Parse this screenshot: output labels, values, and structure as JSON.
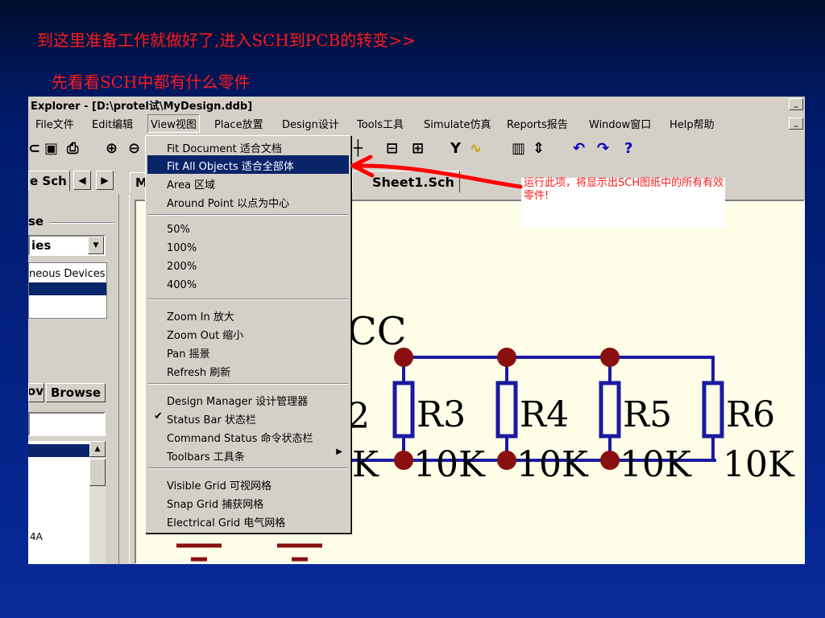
{
  "slide": {
    "line1": "到这里准备工作就做好了,进入SCH到PCB的转变>>",
    "line2": "先看看SCH中都有什么零件"
  },
  "window": {
    "title": "Explorer - [D:\\protel试\\MyDesign.ddb]",
    "min_label": "_"
  },
  "menubar": {
    "items": [
      {
        "label": "File文件"
      },
      {
        "label": "Edit编辑"
      },
      {
        "label": "View视图"
      },
      {
        "label": "Place放置"
      },
      {
        "label": "Design设计"
      },
      {
        "label": "Tools工具"
      },
      {
        "label": "Simulate仿真"
      },
      {
        "label": "Reports报告"
      },
      {
        "label": "Window窗口"
      },
      {
        "label": "Help帮助"
      }
    ],
    "active": "View视图"
  },
  "left_panel": {
    "tab_label": "e Sch",
    "prev_arrow": "◀",
    "next_arrow": "▶",
    "group_label": "se",
    "library_value": "ies",
    "library_item": "neous Devices",
    "add_button_partial": "ov",
    "browse_button": "Browse",
    "part_item": "4A"
  },
  "doc_tabs": {
    "first_tab": "M",
    "sheet_tab": "Sheet1.Sch"
  },
  "view_menu": {
    "items": [
      {
        "label": "Fit Document 适合文档",
        "highlighted": false
      },
      {
        "label": "Fit All Objects 适合全部体",
        "highlighted": true
      },
      {
        "label": "Area 区域",
        "highlighted": false
      },
      {
        "label": "Around Point 以点为中心",
        "highlighted": false
      },
      {
        "label": "50%",
        "highlighted": false
      },
      {
        "label": "100%",
        "highlighted": false
      },
      {
        "label": "200%",
        "highlighted": false
      },
      {
        "label": "400%",
        "highlighted": false
      },
      {
        "label": "Zoom In 放大",
        "highlighted": false
      },
      {
        "label": "Zoom Out 缩小",
        "highlighted": false
      },
      {
        "label": "Pan 摇景",
        "highlighted": false
      },
      {
        "label": "Refresh 刷新",
        "highlighted": false
      },
      {
        "label": "Design Manager 设计管理器",
        "highlighted": false
      },
      {
        "label": "Status Bar 状态栏",
        "highlighted": false,
        "checked": true
      },
      {
        "label": "Command Status 命令状态栏",
        "highlighted": false
      },
      {
        "label": "Toolbars 工具条",
        "highlighted": false,
        "submenu": true
      },
      {
        "label": "Visible Grid 可视网格",
        "highlighted": false
      },
      {
        "label": "Snap Grid 捕获网格",
        "highlighted": false
      },
      {
        "label": "Electrical Grid 电气网格",
        "highlighted": false
      }
    ],
    "check_glyph": "✔",
    "submenu_glyph": "▶"
  },
  "annotation": {
    "text": "运行此项，将显示出SCH图纸中的所有有效零件!",
    "color": "#ff1a1a"
  },
  "schematic": {
    "label_cc": "CC",
    "label_2": "2",
    "label_k": "K",
    "resistors": [
      {
        "name": "R3",
        "value": "10K"
      },
      {
        "name": "R4",
        "value": "10K"
      },
      {
        "name": "R5",
        "value": "10K"
      },
      {
        "name": "R6",
        "value": "10K"
      }
    ],
    "wire_color": "#1a1aa0",
    "junction_color": "#8a1010"
  },
  "colors": {
    "slide_text": "#ff1a1a",
    "menu_highlight": "#0a246a",
    "window_face": "#d4d0c8",
    "canvas_bg": "#fefee8"
  }
}
